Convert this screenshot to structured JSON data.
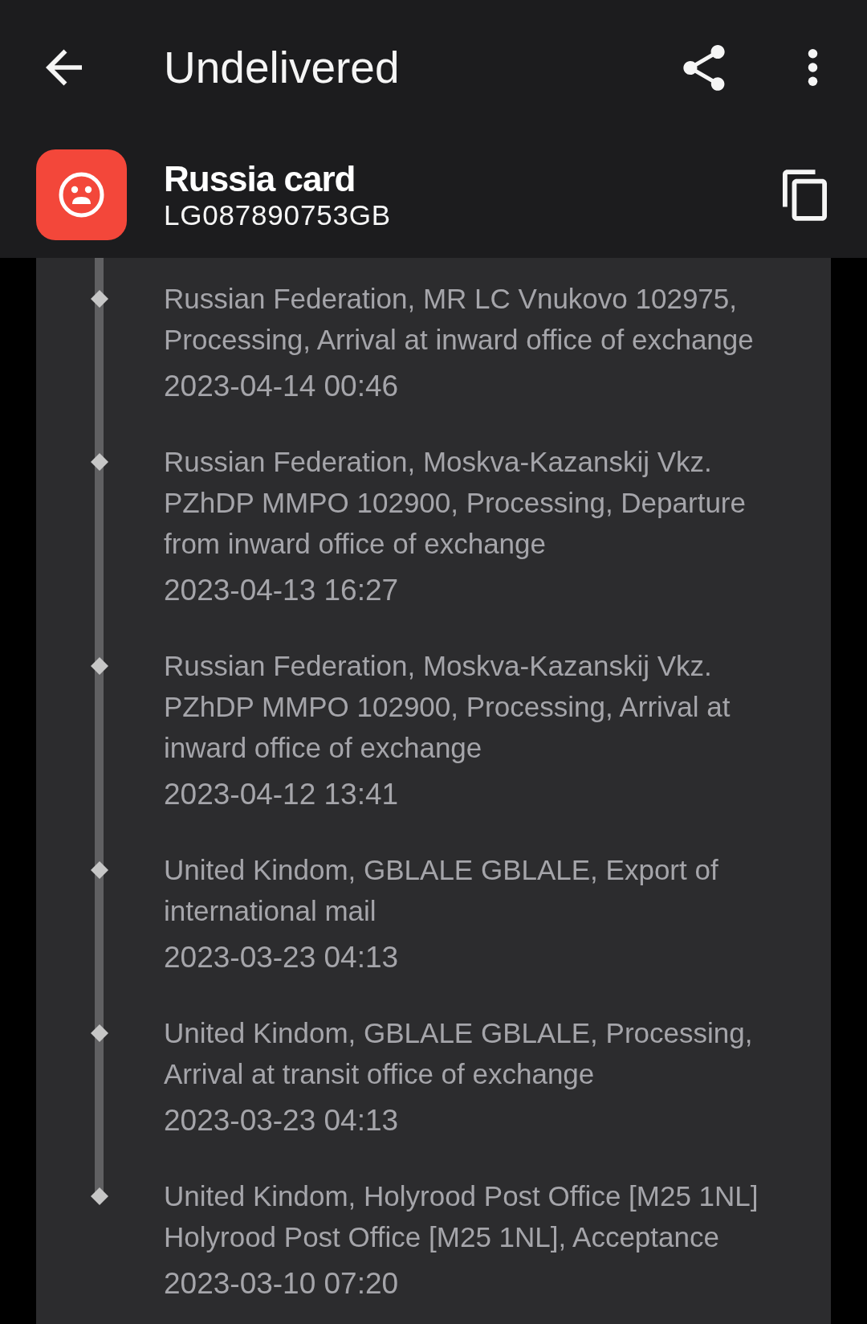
{
  "app_bar": {
    "title": "Undelivered"
  },
  "parcel": {
    "kind": "undelivered",
    "name": "Russia card",
    "tracking_number": "LG087890753GB"
  },
  "events": [
    {
      "text": "Russian Federation, MR LC Vnukovo 102975, Processing, Arrival at inward office of exchange",
      "time": "2023-04-14 00:46"
    },
    {
      "text": "Russian Federation, Moskva-Kazanskij Vkz. PZhDP MMPO 102900, Processing, Departure from inward office of exchange",
      "time": "2023-04-13 16:27"
    },
    {
      "text": "Russian Federation, Moskva-Kazanskij Vkz. PZhDP MMPO 102900, Processing, Arrival at inward office of exchange",
      "time": "2023-04-12 13:41"
    },
    {
      "text": "United Kindom, GBLALE GBLALE, Export of international mail",
      "time": "2023-03-23 04:13"
    },
    {
      "text": "United Kindom, GBLALE GBLALE, Processing, Arrival at transit office of exchange",
      "time": "2023-03-23 04:13"
    },
    {
      "text": "United Kindom, Holyrood Post Office [M25 1NL] Holyrood Post Office [M25 1NL], Acceptance",
      "time": "2023-03-10 07:20"
    }
  ]
}
